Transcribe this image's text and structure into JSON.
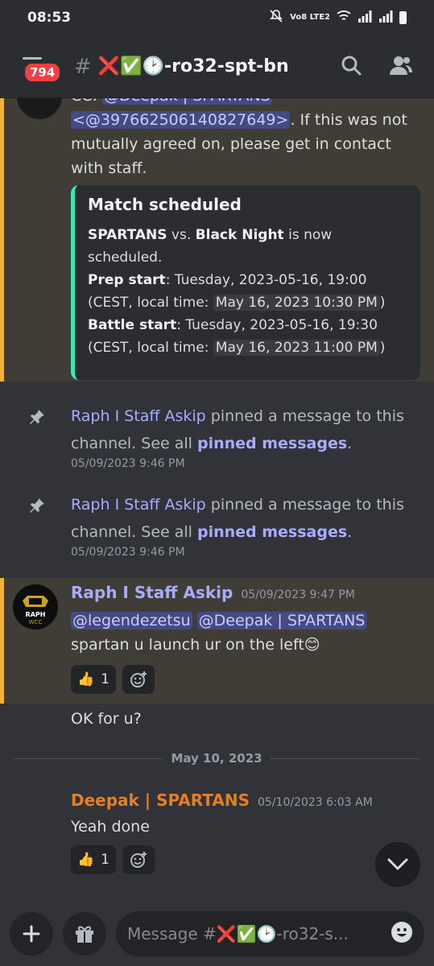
{
  "status_bar": {
    "time": "08:53",
    "network": "Vo8 LTE2"
  },
  "header": {
    "unread_badge": "794",
    "channel_name": "❌✅🕑-ro32-spt-bn"
  },
  "messages": {
    "partial": {
      "mention_user": "@Deepak | SPARTANS",
      "mention_id": "<@397662506140827649>",
      "text_after": ". If this was not mutually agreed on, please get in contact with staff.",
      "cc_prefix": "CC: "
    },
    "embed": {
      "title": "Match scheduled",
      "team1": "SPARTANS",
      "vs": " vs. ",
      "team2": "Black Night",
      "status": " is now scheduled.",
      "prep_label": "Prep start",
      "prep_value": ": Tuesday, 2023-05-16, 19:00 (CEST, local time: ",
      "prep_local": "May 16, 2023 10:30 PM",
      "battle_label": "Battle start",
      "battle_value": ": Tuesday, 2023-05-16, 19:30 (CEST, local time: ",
      "battle_local": "May 16, 2023 11:00 PM",
      "close_paren": ")"
    },
    "pin1": {
      "author": "Raph I Staff Askip",
      "text": " pinned a message to this channel. See all ",
      "link": "pinned messages",
      "end": ".",
      "time": "05/09/2023 9:46 PM"
    },
    "pin2": {
      "author": "Raph I Staff Askip",
      "text": " pinned a message to this channel. See all ",
      "link": "pinned messages",
      "end": ".",
      "time": "05/09/2023 9:46 PM"
    },
    "raph": {
      "author": "Raph I Staff Askip",
      "time": "05/09/2023 9:47 PM",
      "mention1": "@legendezetsu",
      "mention2": "@Deepak | SPARTANS",
      "text": " spartan u launch ur on the left",
      "emoji": "😊",
      "avatar_label": "RAPH",
      "avatar_sub": "WCC",
      "reaction_emoji": "👍",
      "reaction_count": "1",
      "followup": "OK for u?"
    },
    "date_divider": "May 10, 2023",
    "deepak": {
      "author": "Deepak | SPARTANS",
      "time": "05/10/2023 6:03 AM",
      "text": "Yeah done",
      "reaction_emoji": "👍",
      "reaction_count": "1"
    }
  },
  "composer": {
    "placeholder": "Message #❌✅🕑-ro32-s..."
  },
  "colors": {
    "background": "#313338",
    "highlight": "#3f3d36",
    "highlight_bar": "#f0b232",
    "embed_bar": "#3be5b6",
    "mention_bg": "#454a82",
    "staff_name": "#a9abff",
    "deepak_name": "#e67e22"
  }
}
